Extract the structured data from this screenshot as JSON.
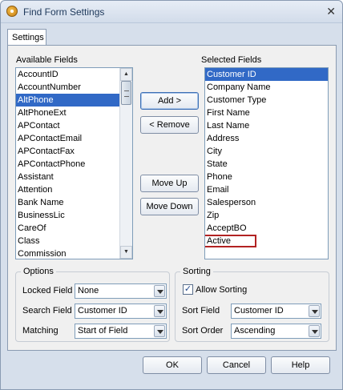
{
  "window": {
    "title": "Find Form Settings",
    "close_glyph": "✕",
    "app_icon": "app-icon"
  },
  "tabs": [
    {
      "label": "Settings"
    }
  ],
  "available": {
    "label": "Available Fields",
    "items": [
      "AccountID",
      "AccountNumber",
      "AltPhone",
      "AltPhoneExt",
      "APContact",
      "APContactEmail",
      "APContactFax",
      "APContactPhone",
      "Assistant",
      "Attention",
      "Bank Name",
      "BusinessLic",
      "CareOf",
      "Class",
      "Commission"
    ],
    "selected_index": 2
  },
  "selected": {
    "label": "Selected Fields",
    "items": [
      "Customer ID",
      "Company Name",
      "Customer Type",
      "First Name",
      "Last Name",
      "Address",
      "City",
      "State",
      "Phone",
      "Email",
      "Salesperson",
      "Zip",
      "AcceptBO",
      "Active"
    ],
    "selected_index": 0,
    "highlight_index": 13
  },
  "buttons": {
    "add": "Add >",
    "remove": "< Remove",
    "move_up": "Move Up",
    "move_down": "Move Down",
    "ok": "OK",
    "cancel": "Cancel",
    "help": "Help"
  },
  "options": {
    "title": "Options",
    "locked_label": "Locked Field",
    "locked_value": "None",
    "search_label": "Search Field",
    "search_value": "Customer ID",
    "matching_label": "Matching",
    "matching_value": "Start of Field"
  },
  "sorting": {
    "title": "Sorting",
    "allow_label": "Allow Sorting",
    "allow_checked": true,
    "check_glyph": "✓",
    "sort_field_label": "Sort Field",
    "sort_field_value": "Customer ID",
    "sort_order_label": "Sort Order",
    "sort_order_value": "Ascending"
  },
  "colors": {
    "selection": "#3169c6",
    "highlight_border": "#b22222"
  }
}
